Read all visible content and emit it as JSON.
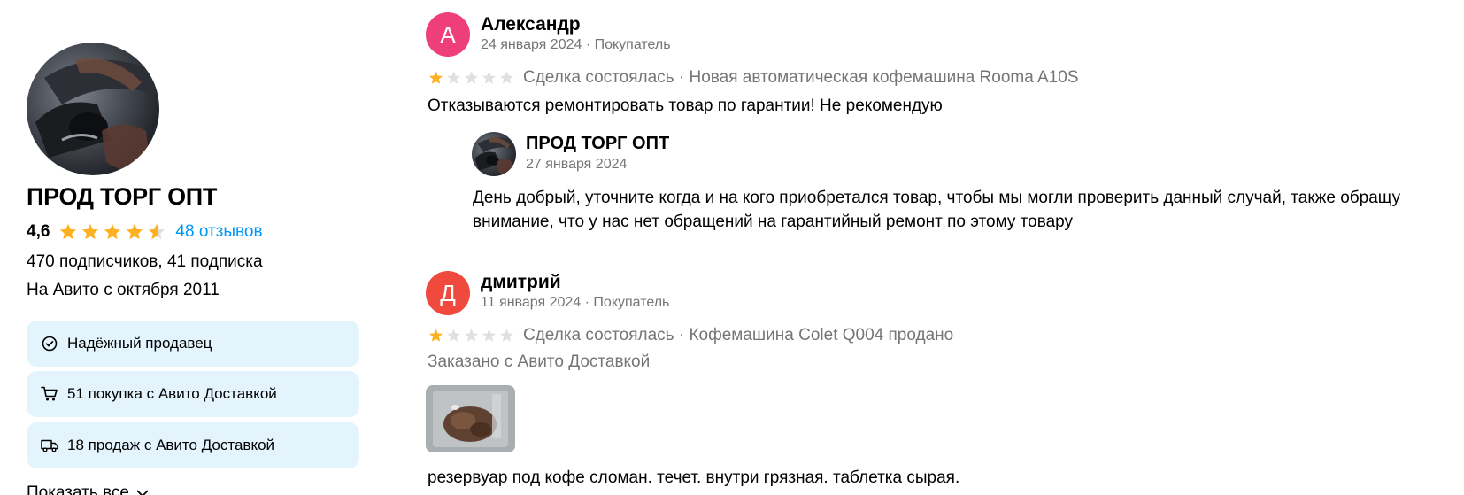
{
  "seller": {
    "name": "ПРОД ТОРГ ОПТ",
    "rating": "4,6",
    "rating_value": 4.6,
    "reviews_link": "48 отзывов",
    "subscribers": "470 подписчиков, 41 подписка",
    "since": "На Авито с октября 2011",
    "badges": [
      {
        "label": "Надёжный продавец",
        "icon": "check-circle-icon"
      },
      {
        "label": "51 покупка с Авито Доставкой",
        "icon": "cart-icon"
      },
      {
        "label": "18 продаж с Авито Доставкой",
        "icon": "truck-icon"
      }
    ],
    "show_all": "Показать все"
  },
  "reviews": [
    {
      "initial": "А",
      "avatar_color": "#ef3f7a",
      "name": "Александр",
      "meta": "24 января 2024 · Покупатель",
      "stars": 1,
      "deal": "Сделка состоялась · Новая автоматическая кофемашина Rooma A10S",
      "text": "Отказываются ремонтировать товар по гарантии! Не рекомендую",
      "reply": {
        "name": "ПРОД ТОРГ ОПТ",
        "date": "27 января 2024",
        "text": "День добрый, уточните когда и на кого приобретался товар, чтобы мы могли проверить данный случай, также обращу внимание, что у нас нет обращений на гарантийный ремонт по этому товару"
      }
    },
    {
      "initial": "Д",
      "avatar_color": "#f04a3f",
      "name": "дмитрий",
      "meta": "11 января 2024 · Покупатель",
      "stars": 1,
      "deal": "Сделка состоялась · Кофемашина Colet Q004 продано",
      "delivery": "Заказано с Авито Доставкой",
      "text": "резервуар под кофе сломан. течет. внутри грязная. таблетка сырая."
    }
  ],
  "colors": {
    "star_filled": "#ffb021",
    "star_empty": "#e0e0e0",
    "link": "#0099f7",
    "badge_bg": "#e3f4fd",
    "muted": "#757575"
  }
}
